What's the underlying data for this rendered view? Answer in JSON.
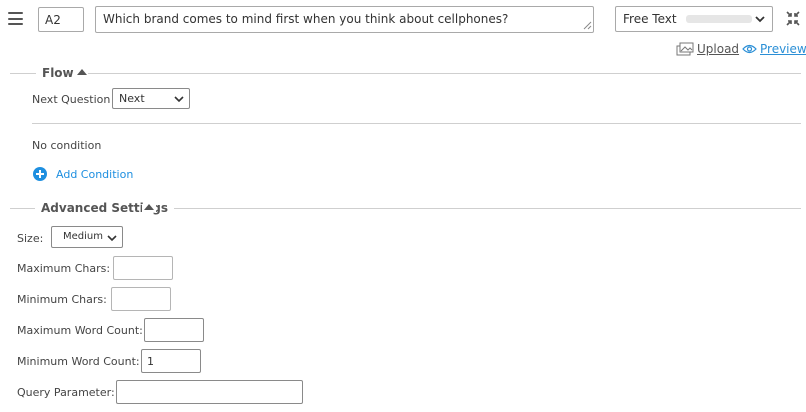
{
  "question": {
    "id": "A2",
    "text": "Which brand comes to mind first when you think about cellphones?",
    "type": "Free Text"
  },
  "actions": {
    "upload_label": "Upload",
    "preview_label": "Preview"
  },
  "flow": {
    "title": "Flow",
    "next_question_label": "Next Question",
    "next_question_value": "Next",
    "condition_text": "No condition",
    "add_condition_label": "Add Condition"
  },
  "advanced": {
    "title": "Advanced Settings",
    "size_label": "Size:",
    "size_value": "Medium",
    "max_chars_label": "Maximum Chars:",
    "max_chars_value": "",
    "min_chars_label": "Minimum Chars:",
    "min_chars_value": "",
    "max_words_label": "Maximum Word Count:",
    "max_words_value": "",
    "min_words_label": "Minimum Word Count:",
    "min_words_value": "1",
    "query_param_label": "Query Parameter:",
    "query_param_value": ""
  },
  "colors": {
    "accent": "#1e8fe0",
    "link": "#2b8fd6",
    "rule": "#cfcfcf"
  },
  "icons": [
    "menu-icon",
    "resize-grip-icon",
    "chevron-down-icon",
    "collapse-icon",
    "upload-icon",
    "eye-icon",
    "caret-up-icon",
    "add-circle-icon"
  ]
}
